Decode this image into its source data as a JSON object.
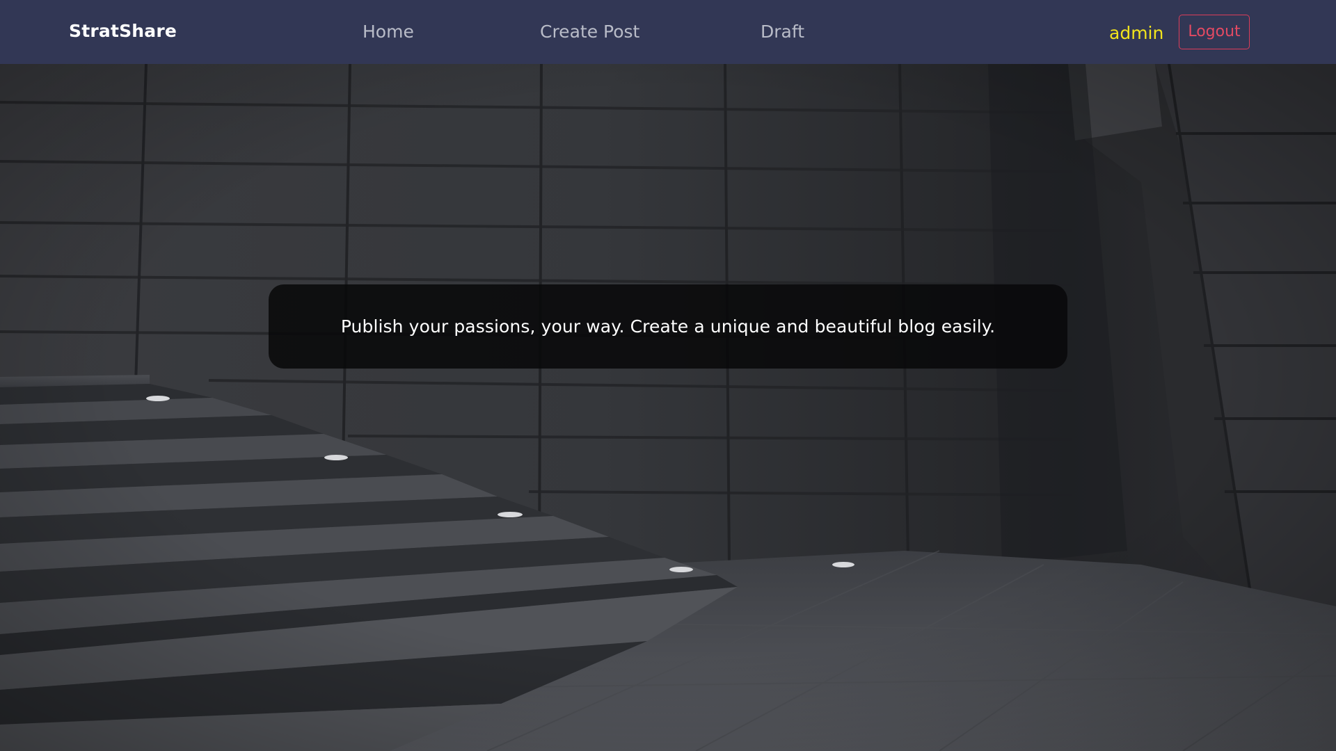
{
  "nav": {
    "brand": "StratShare",
    "links": [
      {
        "label": "Home"
      },
      {
        "label": "Create Post"
      },
      {
        "label": "Draft"
      }
    ],
    "user": "admin",
    "logout_label": "Logout"
  },
  "hero": {
    "tagline": "Publish your passions, your way. Create a unique and beautiful blog easily."
  },
  "colors": {
    "navbar_bg": "#323755",
    "brand_text": "#ffffff",
    "nav_link": "#b9bcc8",
    "user_name": "#f2e41c",
    "logout_accent": "#dc3d5a"
  }
}
